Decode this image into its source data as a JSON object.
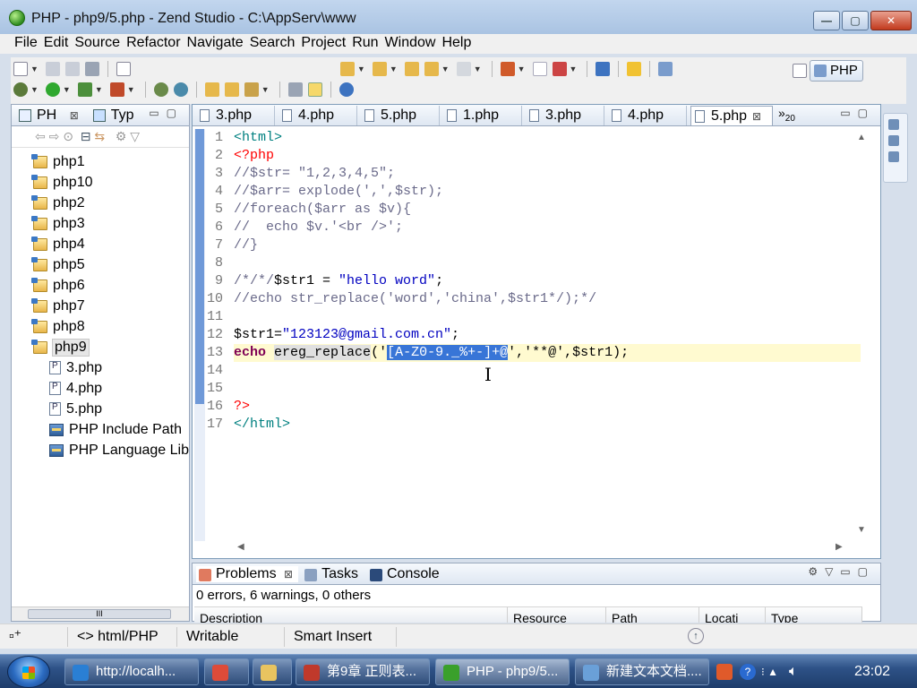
{
  "window": {
    "title": "PHP - php9/5.php - Zend Studio - C:\\AppServ\\www",
    "controls": [
      "—",
      "▢",
      "✕"
    ]
  },
  "menu": [
    "File",
    "Edit",
    "Source",
    "Refactor",
    "Navigate",
    "Search",
    "Project",
    "Run",
    "Window",
    "Help"
  ],
  "perspective": {
    "label": "PHP"
  },
  "left_view": {
    "tabs": [
      {
        "label": "PH",
        "close": "⊠"
      },
      {
        "label": "Typ"
      }
    ],
    "tree": [
      {
        "label": "php1",
        "type": "folder",
        "indent": 0
      },
      {
        "label": "php10",
        "type": "folder",
        "indent": 0
      },
      {
        "label": "php2",
        "type": "folder",
        "indent": 0
      },
      {
        "label": "php3",
        "type": "folder",
        "indent": 0
      },
      {
        "label": "php4",
        "type": "folder",
        "indent": 0
      },
      {
        "label": "php5",
        "type": "folder",
        "indent": 0
      },
      {
        "label": "php6",
        "type": "folder",
        "indent": 0
      },
      {
        "label": "php7",
        "type": "folder",
        "indent": 0
      },
      {
        "label": "php8",
        "type": "folder",
        "indent": 0
      },
      {
        "label": "php9",
        "type": "folder",
        "indent": 0,
        "selected": true
      },
      {
        "label": "3.php",
        "type": "file",
        "indent": 1
      },
      {
        "label": "4.php",
        "type": "file",
        "indent": 1
      },
      {
        "label": "5.php",
        "type": "file",
        "indent": 1
      },
      {
        "label": "PHP Include Path",
        "type": "lib",
        "indent": 1
      },
      {
        "label": "PHP Language Lib",
        "type": "lib",
        "indent": 1
      }
    ],
    "scroll_thumb": "III"
  },
  "editor": {
    "tabs": [
      {
        "label": "3.php"
      },
      {
        "label": "4.php"
      },
      {
        "label": "5.php"
      },
      {
        "label": "1.php"
      },
      {
        "label": "3.php"
      },
      {
        "label": "4.php"
      },
      {
        "label": "5.php",
        "active": true,
        "close": "⊠"
      }
    ],
    "overflow": {
      "label": "»",
      "count": "20"
    },
    "lines": [
      {
        "n": "1",
        "tokens": [
          [
            "k-tag",
            "<html>"
          ]
        ]
      },
      {
        "n": "2",
        "tokens": [
          [
            "k-php",
            "<?php"
          ]
        ]
      },
      {
        "n": "3",
        "tokens": [
          [
            "k-cmt",
            "//$str= \"1,2,3,4,5\";"
          ]
        ]
      },
      {
        "n": "4",
        "tokens": [
          [
            "k-cmt",
            "//$arr= explode(',',$str);"
          ]
        ]
      },
      {
        "n": "5",
        "tokens": [
          [
            "k-cmt",
            "//foreach($arr as $v){"
          ]
        ]
      },
      {
        "n": "6",
        "tokens": [
          [
            "k-cmt",
            "//  echo $v.'<br />';"
          ]
        ]
      },
      {
        "n": "7",
        "tokens": [
          [
            "k-cmt",
            "//}"
          ]
        ]
      },
      {
        "n": "8",
        "tokens": []
      },
      {
        "n": "9",
        "tokens": [
          [
            "k-cmt",
            "/*/*/"
          ],
          [
            "k-var",
            "$str1 = "
          ],
          [
            "k-str",
            "\"hello word\""
          ],
          [
            "k-var",
            ";"
          ]
        ]
      },
      {
        "n": "10",
        "tokens": [
          [
            "k-cmt",
            "//echo str_replace('word','china',$str1*/);*/"
          ]
        ]
      },
      {
        "n": "11",
        "tokens": []
      },
      {
        "n": "12",
        "tokens": [
          [
            "k-var",
            "$str1="
          ],
          [
            "k-str",
            "\"123123@gmail.com.cn\""
          ],
          [
            "k-var",
            ";"
          ]
        ]
      },
      {
        "n": "13",
        "current": true,
        "tokens": [
          [
            "k-kw",
            "echo"
          ],
          [
            "k-var",
            " "
          ],
          [
            "k-fn",
            "ereg_replace"
          ],
          [
            "k-var",
            "('"
          ],
          [
            "k-sel",
            "[A-Z0-9._%+-]+@"
          ],
          [
            "k-var",
            "','**@',$str1);"
          ]
        ]
      },
      {
        "n": "14",
        "tokens": []
      },
      {
        "n": "15",
        "tokens": []
      },
      {
        "n": "16",
        "tokens": [
          [
            "k-php",
            "?>"
          ]
        ]
      },
      {
        "n": "17",
        "tokens": [
          [
            "k-tag",
            "</html>"
          ]
        ]
      }
    ]
  },
  "problems": {
    "tabs": [
      {
        "label": "Problems",
        "close": "⊠",
        "active": true
      },
      {
        "label": "Tasks"
      },
      {
        "label": "Console"
      }
    ],
    "summary": "0 errors, 6 warnings, 0 others",
    "columns": [
      "Description",
      "Resource",
      "Path",
      "Locati",
      "Type"
    ]
  },
  "status": {
    "content_type": "html/PHP",
    "mode": "Writable",
    "insert": "Smart Insert"
  },
  "taskbar": {
    "items": [
      {
        "label": "http://localh...",
        "color": "#2a7fd4"
      },
      {
        "label": "",
        "color": "#dd4b39"
      },
      {
        "label": "",
        "color": "#e8c460"
      },
      {
        "label": "第9章 正则表...",
        "color": "#c0392b"
      },
      {
        "label": "PHP - php9/5...",
        "color": "#3aa02b",
        "active": true
      },
      {
        "label": "新建文本文档....",
        "color": "#6aa0d8"
      }
    ],
    "clock": "23:02"
  }
}
